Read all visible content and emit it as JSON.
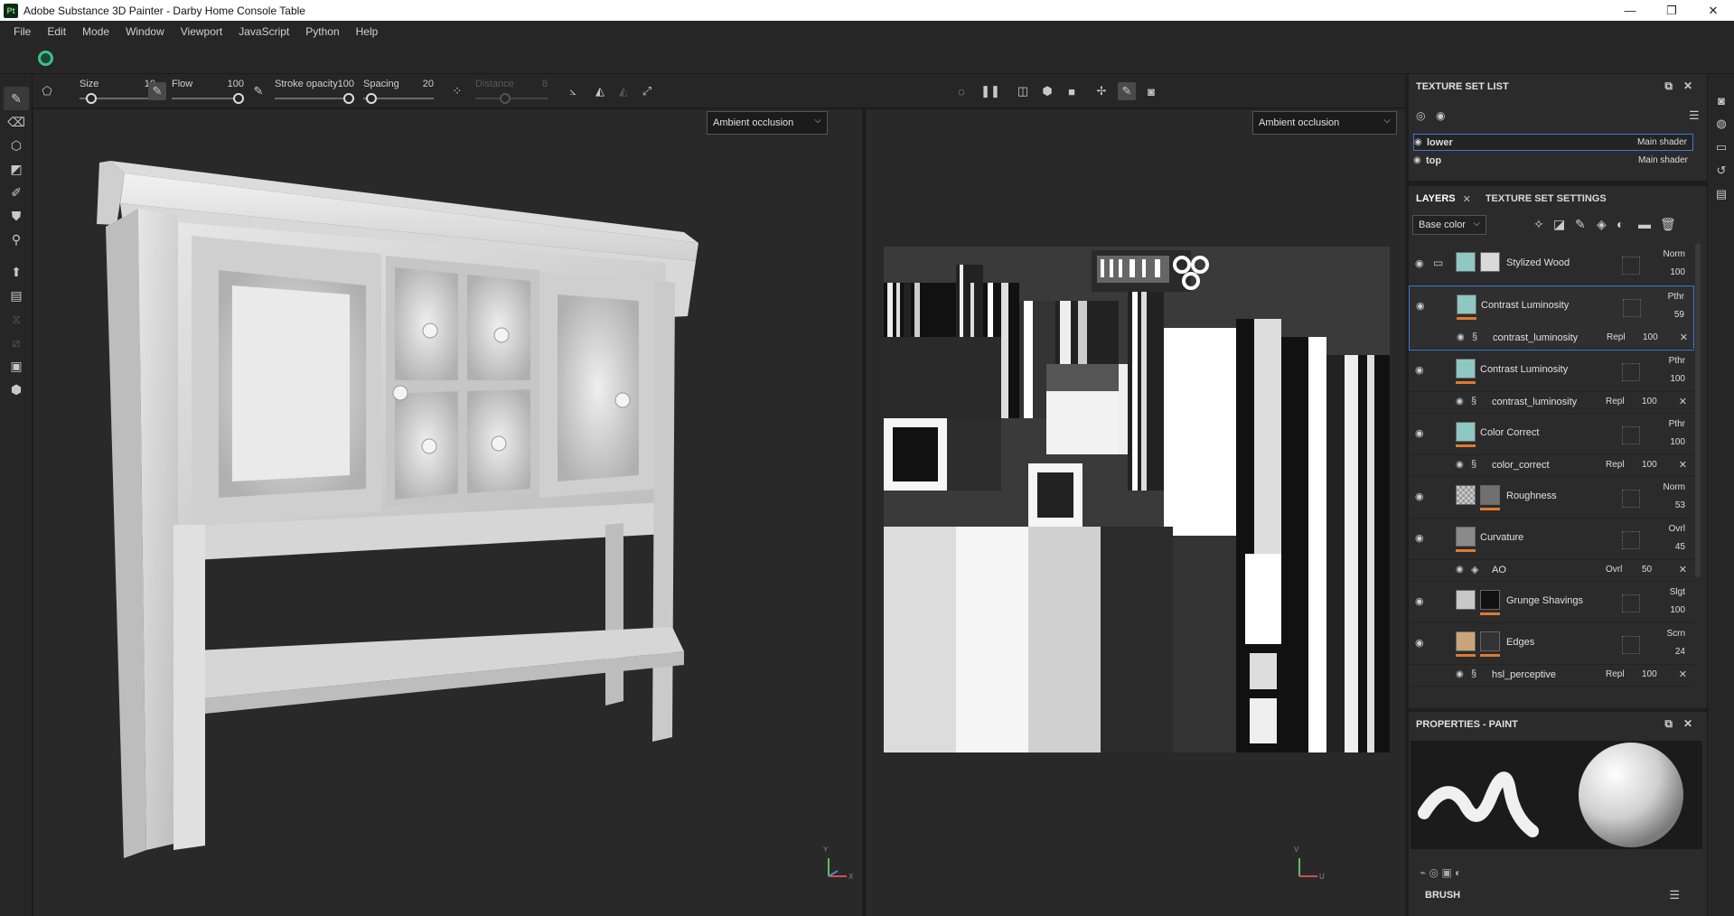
{
  "window": {
    "app_icon": "Pt",
    "title": "Adobe Substance 3D Painter - Darby Home Console Table",
    "min": "—",
    "max": "❐",
    "close": "✕"
  },
  "menu": [
    "File",
    "Edit",
    "Mode",
    "Window",
    "Viewport",
    "JavaScript",
    "Python",
    "Help"
  ],
  "toolbar": {
    "size": {
      "label": "Size",
      "value": "10",
      "level": 0.1
    },
    "flow": {
      "label": "Flow",
      "value": "100",
      "level": 1.0
    },
    "stroke_opacity": {
      "label": "Stroke opacity",
      "value": "100",
      "level": 1.0
    },
    "spacing": {
      "label": "Spacing",
      "value": "20",
      "level": 0.05
    },
    "distance": {
      "label": "Distance",
      "value": "8",
      "level": 0.4
    }
  },
  "viewport3d": {
    "channel": "Ambient occlusion"
  },
  "viewport2d": {
    "channel": "Ambient occlusion"
  },
  "texture_set_list": {
    "title": "TEXTURE SET LIST",
    "sets": [
      {
        "name": "lower",
        "shader": "Main shader"
      },
      {
        "name": "top",
        "shader": "Main shader"
      }
    ]
  },
  "layers_panel": {
    "tabs": [
      "LAYERS",
      "TEXTURE SET SETTINGS"
    ],
    "channel": "Base color",
    "layers": [
      {
        "name": "Stylized Wood",
        "blend": "Norm",
        "opacity": "100",
        "thumb1": "#8fc7c2",
        "thumb2": "#d9d9d9"
      },
      {
        "name": "Contrast Luminosity",
        "blend": "Pthr",
        "opacity": "59",
        "thumb1": "#8fc7c2",
        "sub": {
          "name": "contrast_luminosity",
          "blend": "Repl",
          "opacity": "100"
        }
      },
      {
        "name": "Contrast Luminosity",
        "blend": "Pthr",
        "opacity": "100",
        "thumb1": "#8fc7c2",
        "sub": {
          "name": "contrast_luminosity",
          "blend": "Repl",
          "opacity": "100"
        }
      },
      {
        "name": "Color Correct",
        "blend": "Pthr",
        "opacity": "100",
        "thumb1": "#8fc7c2",
        "sub": {
          "name": "color_correct",
          "blend": "Repl",
          "opacity": "100"
        }
      },
      {
        "name": "Roughness",
        "blend": "Norm",
        "opacity": "53",
        "thumb1": "#9a9a9a",
        "thumb2": "#707070"
      },
      {
        "name": "Curvature",
        "blend": "Ovrl",
        "opacity": "45",
        "thumb1": "#8a8a8a",
        "sub": {
          "name": "AO",
          "blend": "Ovrl",
          "opacity": "50"
        }
      },
      {
        "name": "Grunge Shavings",
        "blend": "Slgt",
        "opacity": "100",
        "thumb1": "#c8c8c8",
        "thumb2": "#111111"
      },
      {
        "name": "Edges",
        "blend": "Scrn",
        "opacity": "24",
        "thumb1": "#c9a57a",
        "thumb2": "#333333",
        "sub": {
          "name": "hsl_perceptive",
          "blend": "Repl",
          "opacity": "100"
        }
      }
    ]
  },
  "properties": {
    "title": "PROPERTIES - PAINT",
    "section": "BRUSH"
  },
  "axes": {
    "x": "X",
    "y": "Y",
    "u": "U",
    "v": "V"
  }
}
